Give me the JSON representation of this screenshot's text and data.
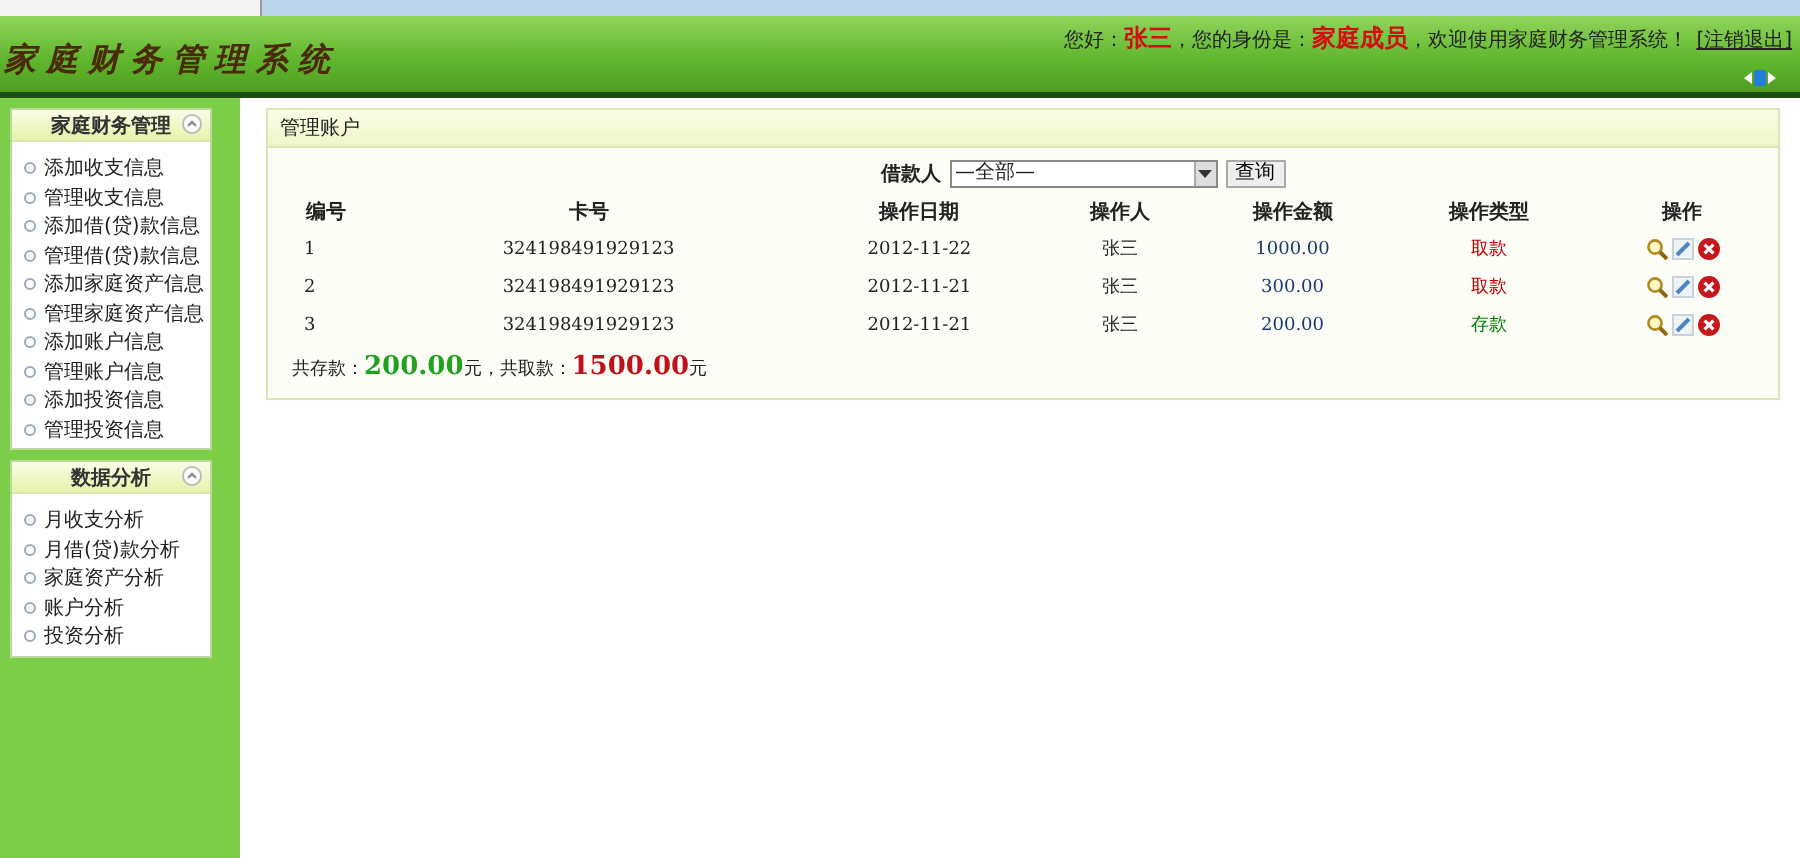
{
  "header": {
    "title": "家庭财务管理系统",
    "greeting": "您好：",
    "user": "张三",
    "role_label": "，您的身份是：",
    "role": "家庭成员",
    "welcome": "，欢迎使用家庭财务管理系统！",
    "logout": "[注销退出]"
  },
  "sidebar": {
    "sections": [
      {
        "title": "家庭财务管理",
        "expanded": true,
        "items": [
          "添加收支信息",
          "管理收支信息",
          "添加借(贷)款信息",
          "管理借(贷)款信息",
          "添加家庭资产信息",
          "管理家庭资产信息",
          "添加账户信息",
          "管理账户信息",
          "添加投资信息",
          "管理投资信息"
        ]
      },
      {
        "title": "数据分析",
        "expanded": true,
        "items": [
          "月收支分析",
          "月借(贷)款分析",
          "家庭资产分析",
          "账户分析",
          "投资分析"
        ]
      }
    ]
  },
  "panel": {
    "title": "管理账户",
    "filter": {
      "label": "借款人",
      "value": "—全部—",
      "button": "查询"
    },
    "table": {
      "columns": [
        "编号",
        "卡号",
        "操作日期",
        "操作人",
        "操作金额",
        "操作类型",
        "操作"
      ],
      "rows": [
        {
          "id": "1",
          "card": "324198491929123",
          "date": "2012-11-22",
          "operator": "张三",
          "amount": "1000.00",
          "type": "取款",
          "color": "#c00000"
        },
        {
          "id": "2",
          "card": "324198491929123",
          "date": "2012-11-21",
          "operator": "张三",
          "amount": "300.00",
          "type": "取款",
          "color": "#c00000"
        },
        {
          "id": "3",
          "card": "324198491929123",
          "date": "2012-11-21",
          "operator": "张三",
          "amount": "200.00",
          "type": "存款",
          "color": "#008000"
        }
      ]
    },
    "summary": {
      "deposit_label": "共存款：",
      "deposit": "200.00",
      "unit1": "元，共取款：",
      "withdraw": "1500.00",
      "unit2": "元"
    }
  }
}
